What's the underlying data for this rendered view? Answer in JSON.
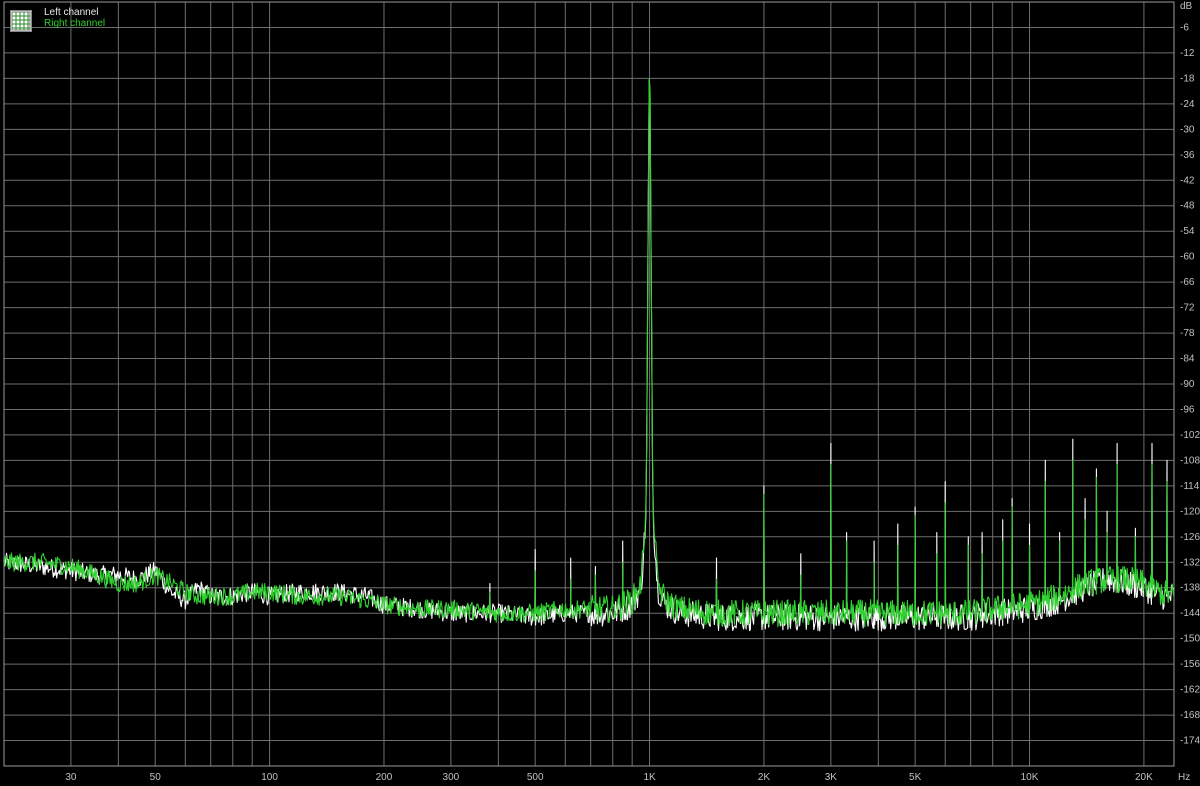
{
  "chart_data": {
    "type": "line",
    "title": "",
    "xlabel": "",
    "ylabel": "",
    "x_unit": "Hz",
    "y_unit": "dB",
    "x_scale": "log",
    "xlim": [
      20,
      24000
    ],
    "ylim": [
      -180,
      0
    ],
    "grid": true,
    "legend": "top-left",
    "background": "#000000",
    "grid_color": "#6e6e6e",
    "x_ticks": [
      {
        "v": 30,
        "label": "30"
      },
      {
        "v": 50,
        "label": "50"
      },
      {
        "v": 100,
        "label": "100"
      },
      {
        "v": 200,
        "label": "200"
      },
      {
        "v": 300,
        "label": "300"
      },
      {
        "v": 500,
        "label": "500"
      },
      {
        "v": 1000,
        "label": "1K"
      },
      {
        "v": 2000,
        "label": "2K"
      },
      {
        "v": 3000,
        "label": "3K"
      },
      {
        "v": 5000,
        "label": "5K"
      },
      {
        "v": 10000,
        "label": "10K"
      },
      {
        "v": 20000,
        "label": "20K"
      }
    ],
    "x_grid": [
      20,
      30,
      40,
      50,
      60,
      70,
      80,
      90,
      100,
      200,
      300,
      400,
      500,
      600,
      700,
      800,
      900,
      1000,
      2000,
      3000,
      4000,
      5000,
      6000,
      7000,
      8000,
      9000,
      10000,
      20000
    ],
    "y_ticks": [
      -6,
      -12,
      -18,
      -24,
      -30,
      -36,
      -42,
      -48,
      -54,
      -60,
      -66,
      -72,
      -78,
      -84,
      -90,
      -96,
      -102,
      -108,
      -114,
      -120,
      -126,
      -132,
      -138,
      -144,
      -150,
      -156,
      -162,
      -168,
      -174
    ],
    "series": [
      {
        "name": "Left channel",
        "color": "#ffffff",
        "x": [
          20,
          25,
          30,
          35,
          40,
          45,
          50,
          55,
          60,
          65,
          70,
          80,
          90,
          100,
          120,
          150,
          180,
          200,
          250,
          300,
          400,
          500,
          600,
          700,
          800,
          900,
          950,
          980,
          1000,
          1020,
          1050,
          1100,
          1200,
          1500,
          2000,
          2500,
          3000,
          4000,
          5000,
          6000,
          7000,
          8000,
          10000,
          12000,
          14000,
          16000,
          18000,
          20000,
          22000,
          24000
        ],
        "y": [
          -132,
          -133,
          -134,
          -135,
          -135,
          -136,
          -134,
          -139,
          -141,
          -138,
          -140,
          -140,
          -139,
          -140,
          -139,
          -139,
          -140,
          -142,
          -143,
          -144,
          -144,
          -145,
          -144,
          -144,
          -144,
          -142,
          -138,
          -120,
          -5,
          -120,
          -138,
          -142,
          -144,
          -145,
          -145,
          -145,
          -145,
          -145,
          -145,
          -145,
          -145,
          -144,
          -143,
          -141,
          -138,
          -136,
          -137,
          -138,
          -140,
          -140
        ]
      },
      {
        "name": "Right channel",
        "color": "#2fd22f",
        "x": [
          20,
          25,
          30,
          35,
          40,
          45,
          50,
          55,
          60,
          65,
          70,
          80,
          90,
          100,
          120,
          150,
          180,
          200,
          250,
          300,
          400,
          500,
          600,
          700,
          800,
          900,
          950,
          980,
          1000,
          1020,
          1050,
          1100,
          1200,
          1500,
          2000,
          2500,
          3000,
          4000,
          5000,
          6000,
          7000,
          8000,
          10000,
          12000,
          14000,
          16000,
          18000,
          20000,
          22000,
          24000
        ],
        "y": [
          -132,
          -132,
          -133,
          -135,
          -137,
          -137,
          -135,
          -137,
          -139,
          -140,
          -140,
          -140,
          -139,
          -139,
          -140,
          -140,
          -141,
          -142,
          -143,
          -143,
          -144,
          -144,
          -143,
          -143,
          -143,
          -141,
          -137,
          -118,
          -5,
          -118,
          -137,
          -141,
          -143,
          -144,
          -144,
          -144,
          -144,
          -144,
          -144,
          -144,
          -144,
          -143,
          -142,
          -140,
          -137,
          -136,
          -136,
          -137,
          -139,
          -140
        ]
      }
    ],
    "spurs": [
      {
        "f": 380,
        "db": -139
      },
      {
        "f": 500,
        "db": -134
      },
      {
        "f": 620,
        "db": -136
      },
      {
        "f": 720,
        "db": -135
      },
      {
        "f": 850,
        "db": -132
      },
      {
        "f": 1500,
        "db": -136
      },
      {
        "f": 2000,
        "db": -116
      },
      {
        "f": 2500,
        "db": -135
      },
      {
        "f": 3000,
        "db": -109
      },
      {
        "f": 3300,
        "db": -127
      },
      {
        "f": 3900,
        "db": -132
      },
      {
        "f": 4500,
        "db": -128
      },
      {
        "f": 5000,
        "db": -121
      },
      {
        "f": 5700,
        "db": -130
      },
      {
        "f": 6000,
        "db": -118
      },
      {
        "f": 6900,
        "db": -128
      },
      {
        "f": 7500,
        "db": -130
      },
      {
        "f": 8500,
        "db": -127
      },
      {
        "f": 9000,
        "db": -119
      },
      {
        "f": 10000,
        "db": -128
      },
      {
        "f": 11000,
        "db": -113
      },
      {
        "f": 12000,
        "db": -127
      },
      {
        "f": 13000,
        "db": -108
      },
      {
        "f": 14000,
        "db": -122
      },
      {
        "f": 15000,
        "db": -112
      },
      {
        "f": 16000,
        "db": -125
      },
      {
        "f": 17000,
        "db": -109
      },
      {
        "f": 19000,
        "db": -126
      },
      {
        "f": 21000,
        "db": -109
      },
      {
        "f": 23000,
        "db": -113
      }
    ]
  }
}
